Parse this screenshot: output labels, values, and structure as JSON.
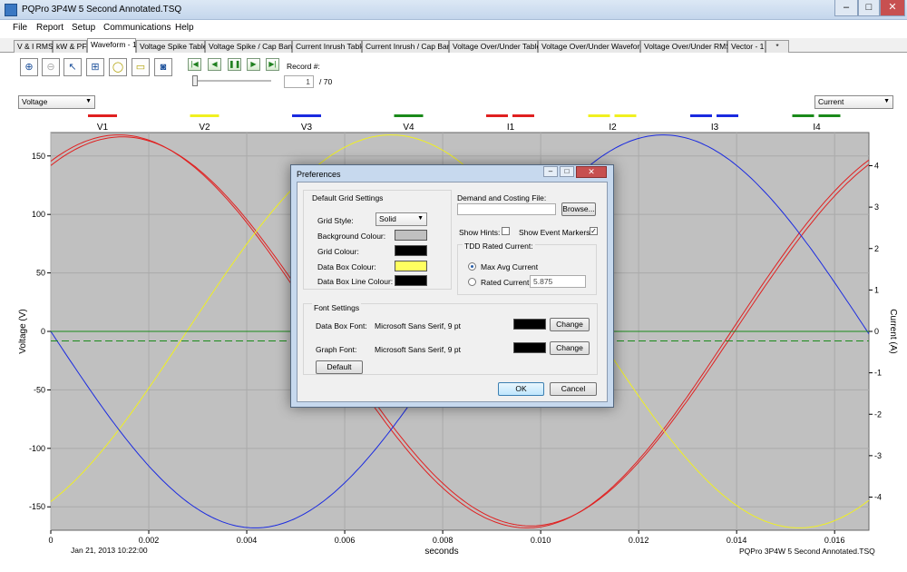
{
  "window": {
    "title": "PQPro 3P4W 5 Second Annotated.TSQ",
    "min": "–",
    "max": "□",
    "close": "✕"
  },
  "menu": [
    "File",
    "Report",
    "Setup",
    "Communications",
    "Help"
  ],
  "tabs": [
    "V & I RMS",
    "kW & PF",
    "Waveform - 1",
    "Voltage Spike Table",
    "Voltage Spike / Cap Bank",
    "Current Inrush Table",
    "Current Inrush / Cap Bank",
    "Voltage Over/Under Table",
    "Voltage Over/Under Waveform",
    "Voltage Over/Under RMS",
    "Vector - 1",
    "*"
  ],
  "active_tab": "Waveform - 1",
  "toolbar": {
    "record_label": "Record #:",
    "record_value": "1",
    "record_total": "/ 70"
  },
  "left_select": "Voltage",
  "right_select": "Current",
  "legend": [
    "V1",
    "V2",
    "V3",
    "V4",
    "I1",
    "I2",
    "I3",
    "I4"
  ],
  "colors": {
    "red": "#e02020",
    "yellow": "#f0f020",
    "blue": "#1a2ae0",
    "green": "#1a8a1a",
    "plot_bg": "#c0c0c0"
  },
  "footer": {
    "date": "Jan 21, 2013 10:22:00",
    "file": "PQPro 3P4W 5 Second Annotated.TSQ"
  },
  "chart_data": {
    "type": "line",
    "xlabel": "seconds",
    "ylabel": "Voltage (V)",
    "y2label": "Current (A)",
    "xlim": [
      0,
      0.0167
    ],
    "ylim": [
      -170,
      170
    ],
    "y2lim": [
      -4.8,
      4.8
    ],
    "x_ticks": [
      "0",
      "0.002",
      "0.004",
      "0.006",
      "0.008",
      "0.010",
      "0.012",
      "0.014",
      "0.016"
    ],
    "y_ticks": [
      "150",
      "100",
      "50",
      "0",
      "-50",
      "-100",
      "-150"
    ],
    "y2_ticks": [
      "4",
      "3",
      "2",
      "1",
      "0",
      "-1",
      "-2",
      "-3",
      "-4"
    ],
    "series": [
      {
        "name": "V1",
        "axis": "left",
        "amplitude": 168,
        "phase_deg": 60,
        "color": "#e02020",
        "double": true
      },
      {
        "name": "V2",
        "axis": "left",
        "amplitude": 168,
        "phase_deg": -60,
        "color": "#f0f020",
        "double": false
      },
      {
        "name": "V3",
        "axis": "left",
        "amplitude": 168,
        "phase_deg": 180,
        "color": "#1a2ae0",
        "double": false
      },
      {
        "name": "V4",
        "axis": "left",
        "amplitude": 0,
        "offset": 0,
        "color": "#1a8a1a",
        "double": false,
        "dashed": false
      },
      {
        "name": "I4",
        "axis": "right",
        "amplitude": 0,
        "offset": -0.23,
        "color": "#1a8a1a",
        "dashed": true
      }
    ]
  },
  "dialog": {
    "title": "Preferences",
    "grid_group": "Default Grid Settings",
    "grid_style_label": "Grid Style:",
    "grid_style_value": "Solid",
    "bg_colour_label": "Background Colour:",
    "grid_colour_label": "Grid Colour:",
    "data_box_colour_label": "Data Box Colour:",
    "data_box_line_label": "Data Box Line Colour:",
    "swatch_bg": "#c0c0c0",
    "swatch_grid": "#000000",
    "swatch_databox": "#ffff60",
    "swatch_line": "#000000",
    "demand_label": "Demand and Costing File:",
    "browse": "Browse...",
    "show_hints": "Show Hints:",
    "show_events": "Show Event Markers",
    "tdd_group": "TDD Rated Current:",
    "max_avg": "Max Avg Current",
    "rated_current": "Rated Current",
    "rated_value": "5.875",
    "font_group": "Font Settings",
    "data_box_font_label": "Data Box Font:",
    "data_box_font_value": "Microsoft Sans Serif, 9 pt",
    "graph_font_label": "Graph Font:",
    "graph_font_value": "Microsoft Sans Serif, 9 pt",
    "change": "Change",
    "default": "Default",
    "ok": "OK",
    "cancel": "Cancel"
  }
}
